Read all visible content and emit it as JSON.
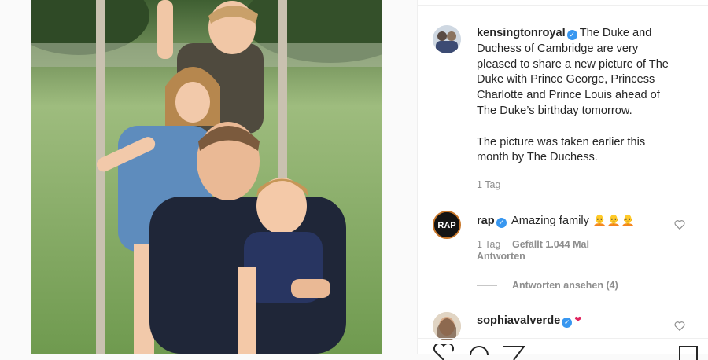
{
  "post": {
    "username": "kensingtonroyal",
    "caption_lines": [
      "The Duke and",
      "Duchess of Cambridge are very",
      "pleased to share a new picture of The",
      "Duke with Prince George, Princess",
      "Charlotte and Prince Louis ahead of",
      "The Duke’s birthday tomorrow.",
      "",
      "The picture was taken earlier this",
      "month by The Duchess."
    ],
    "time": "1 Tag",
    "photo_icon": "family-photo-on-swing"
  },
  "comments": [
    {
      "username": "rap",
      "text": "Amazing family",
      "emoji": "🧑‍🦲🧑‍🦲🧑‍🦲",
      "time": "1 Tag",
      "likes": "Gefällt 1.044 Mal",
      "reply": "Antworten",
      "view_replies": "Antworten ansehen (4)"
    },
    {
      "username": "sophiavalverde",
      "heart_emoji": "❤"
    }
  ],
  "colors": {
    "verified": "#3897f0",
    "text": "#262626",
    "muted": "#8e8e8e"
  }
}
